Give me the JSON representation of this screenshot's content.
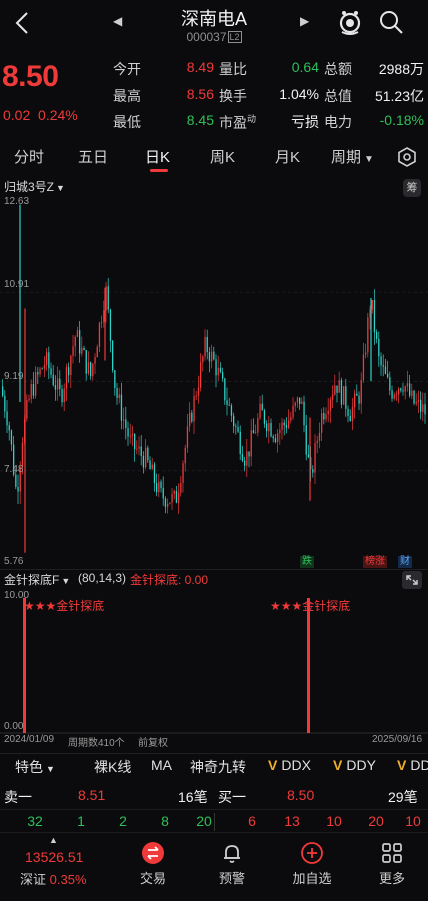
{
  "header": {
    "name": "深南电A",
    "code": "000037",
    "code_tag": "L2"
  },
  "quote": {
    "price": "8.50",
    "change": "0.02",
    "change_pct": "0.24%",
    "rows": [
      [
        {
          "label": "今开",
          "value": "8.49",
          "color": "red"
        },
        {
          "label": "量比",
          "value": "0.64",
          "color": "green"
        },
        {
          "label": "总额",
          "value": "2988万",
          "color": "white"
        }
      ],
      [
        {
          "label": "最高",
          "value": "8.56",
          "color": "red"
        },
        {
          "label": "换手",
          "value": "1.04%",
          "color": "white"
        },
        {
          "label": "总值",
          "value": "51.23亿",
          "color": "white"
        }
      ],
      [
        {
          "label": "最低",
          "value": "8.45",
          "color": "green"
        },
        {
          "label": "市盈",
          "label_sup": "动",
          "value": "亏损",
          "color": "white"
        },
        {
          "label": "电力",
          "value": "-0.18%",
          "color": "green",
          "label_color": "orange"
        }
      ]
    ]
  },
  "tabs": [
    "分时",
    "五日",
    "日K",
    "周K",
    "月K",
    "周期"
  ],
  "active_tab": "日K",
  "main_indicator": {
    "label": "归城3号Z",
    "chip_label": "筹"
  },
  "y_axis": {
    "max": "12.63",
    "t1": "10.91",
    "t2": "9.19",
    "t3": "7.48",
    "min": "5.76"
  },
  "chart_flags": {
    "green_flag": "跌",
    "red_flag": "榜涨",
    "blue_flag": "财"
  },
  "sub_indicator": {
    "name": "金针探底F",
    "params": "(80,14,3)",
    "value_label": "金针探底: 0.00",
    "y_max": "10.00",
    "y_min": "0.00",
    "signal_text": "★★★金针探底"
  },
  "footer": {
    "start_date": "2024/01/09",
    "period_count": "周期数410个",
    "adjust": "前复权",
    "end_date": "2025/09/16"
  },
  "indicator_bar": {
    "special": "特色",
    "items": [
      "裸K线",
      "MA",
      "神奇九转"
    ],
    "v_items": [
      "DDX",
      "DDY",
      "DDZ"
    ]
  },
  "orderbook": {
    "sell_label": "卖一",
    "sell_price": "8.51",
    "sell_vol": "16笔",
    "buy_label": "买一",
    "buy_price": "8.50",
    "buy_vol": "29笔",
    "sell_queue": [
      "32",
      "1",
      "2",
      "8",
      "20"
    ],
    "buy_queue": [
      "6",
      "13",
      "10",
      "20",
      "10"
    ]
  },
  "bottom_nav": {
    "index_value": "13526.51",
    "index_name": "深证",
    "index_change": "0.35%",
    "items": [
      "交易",
      "预警",
      "加自选",
      "更多"
    ]
  },
  "colors": {
    "up": "#f03a3a",
    "down": "#2fd3c8",
    "accent": "#f03a3a",
    "background": "#0b0b0d"
  }
}
